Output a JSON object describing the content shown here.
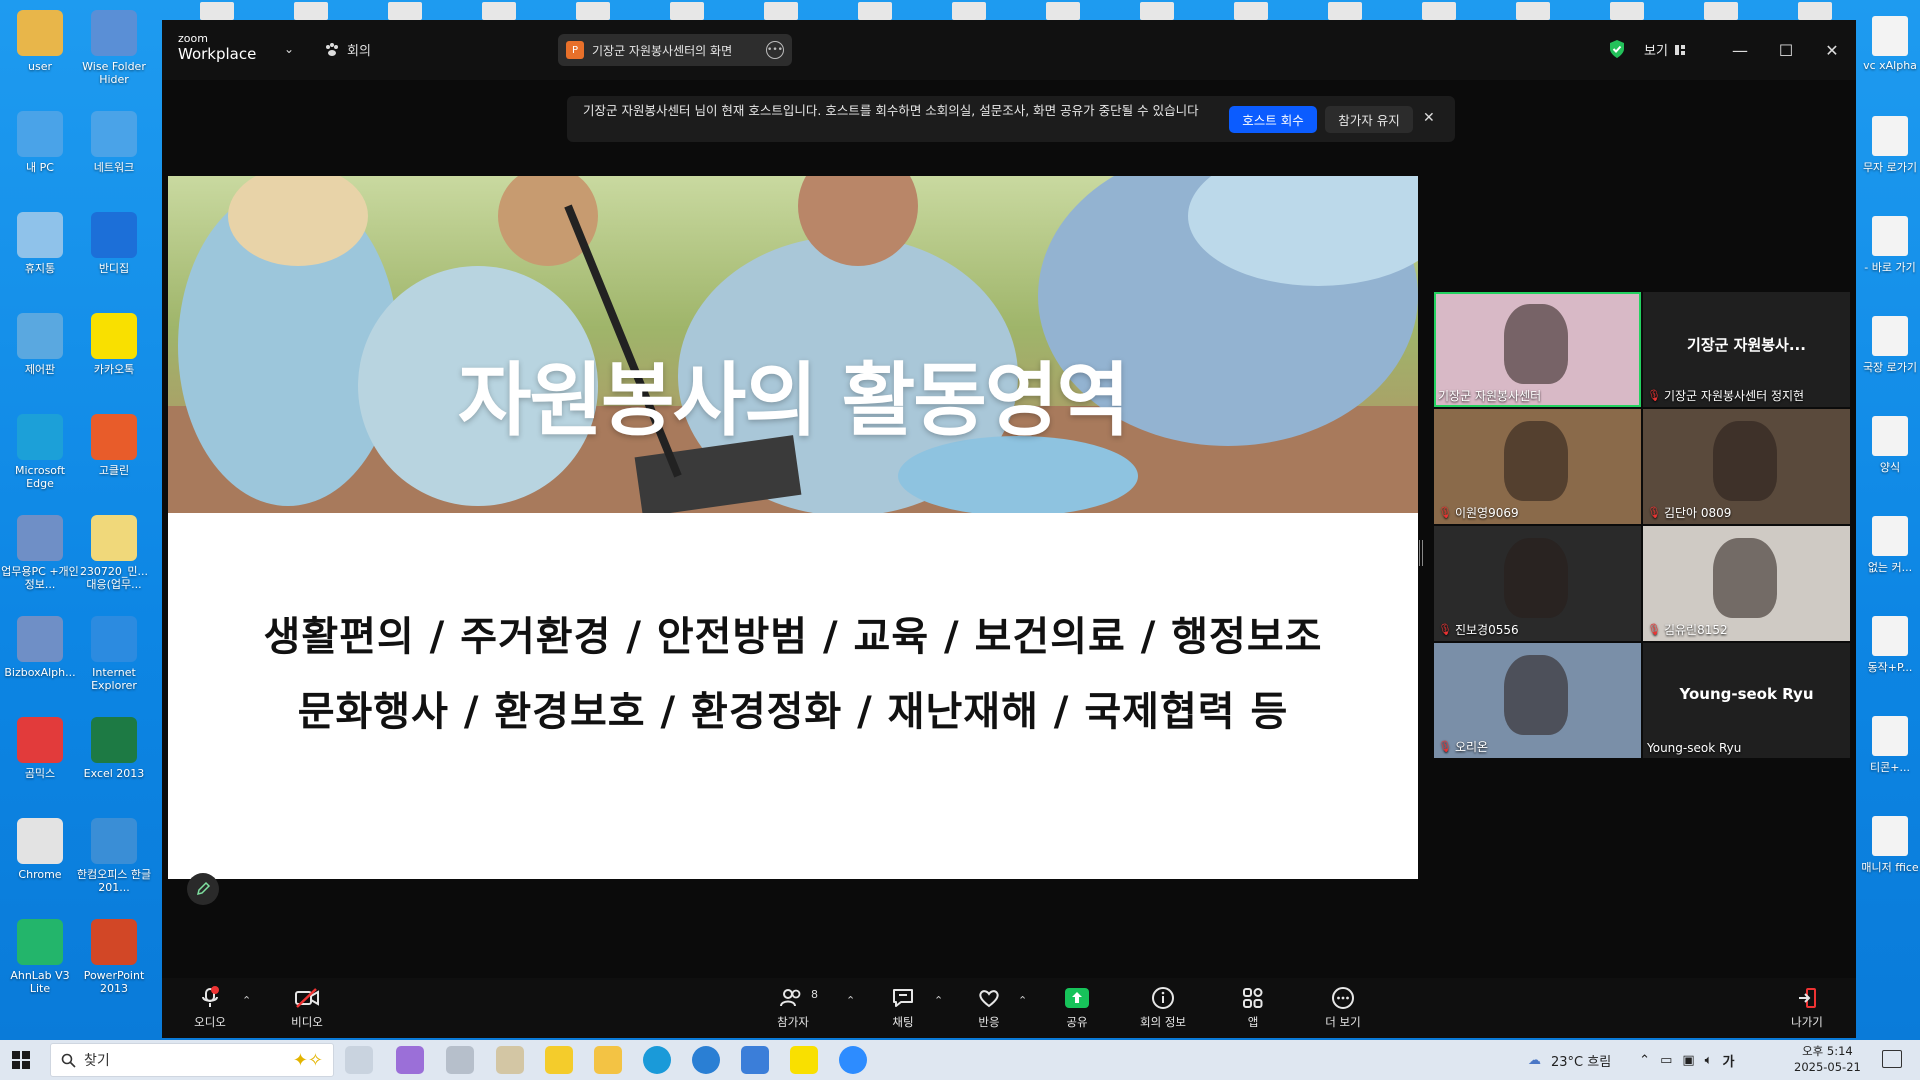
{
  "desktop": {
    "icons": [
      {
        "label": "user",
        "icon": "user-folder-icon",
        "color": "#e8b64a"
      },
      {
        "label": "Wise Folder Hider",
        "icon": "folder-hider-icon",
        "color": "#5a8fd6"
      },
      {
        "label": "내 PC",
        "icon": "pc-icon",
        "color": "#4aa3e8"
      },
      {
        "label": "네트워크",
        "icon": "network-icon",
        "color": "#4aa3e8"
      },
      {
        "label": "휴지통",
        "icon": "recycle-bin-icon",
        "color": "#8fc2ea"
      },
      {
        "label": "반디집",
        "icon": "bandizip-icon",
        "color": "#1c6fd8"
      },
      {
        "label": "제어판",
        "icon": "control-panel-icon",
        "color": "#5aa8e0"
      },
      {
        "label": "카카오톡",
        "icon": "kakaotalk-icon",
        "color": "#f9e000"
      },
      {
        "label": "Microsoft Edge",
        "icon": "edge-icon",
        "color": "#1ca0d8"
      },
      {
        "label": "고클린",
        "icon": "goclean-icon",
        "color": "#e85c2a"
      },
      {
        "label": "업무용PC +개인정보...",
        "icon": "zip-icon",
        "color": "#6f8fc6"
      },
      {
        "label": "230720_민... 대응(업무...",
        "icon": "document-icon",
        "color": "#f0d87a"
      },
      {
        "label": "BizboxAlph...",
        "icon": "zip-icon",
        "color": "#6f8fc6"
      },
      {
        "label": "Internet Explorer",
        "icon": "ie-icon",
        "color": "#2c8be0"
      },
      {
        "label": "곰믹스",
        "icon": "gommix-icon",
        "color": "#e23b3b"
      },
      {
        "label": "Excel 2013",
        "icon": "excel-icon",
        "color": "#1d7a44"
      },
      {
        "label": "Chrome",
        "icon": "chrome-icon",
        "color": "#e3e3e3"
      },
      {
        "label": "한컴오피스 한글 201...",
        "icon": "hancom-icon",
        "color": "#3a8ed6"
      },
      {
        "label": "AhnLab V3 Lite",
        "icon": "v3-icon",
        "color": "#23b56b"
      },
      {
        "label": "PowerPoint 2013",
        "icon": "powerpoint-icon",
        "color": "#d24726"
      }
    ],
    "right_items": [
      {
        "label": "vc xAlpha"
      },
      {
        "label": "무자 로가기"
      },
      {
        "label": "- 바로 가기"
      },
      {
        "label": "국장 로가기"
      },
      {
        "label": "양식"
      },
      {
        "label": "없는 커..."
      },
      {
        "label": "동작+P..."
      },
      {
        "label": "티콘+..."
      },
      {
        "label": "매니저 ffice"
      }
    ]
  },
  "zoom": {
    "logo_line1": "zoom",
    "logo_line2": "Workplace",
    "meeting_label": "회의",
    "share_label": "기장군 자원봉사센터의 화면",
    "view_label": "보기",
    "banner": {
      "text": "기장군 자원봉사센터 님이 현재 호스트입니다. 호스트를 회수하면 소회의실, 설문조사, 화면 공유가 중단될 수 있습니다",
      "reclaim": "호스트 회수",
      "keep": "참가자 유지"
    },
    "slide": {
      "title": "자원봉사의 활동영역",
      "line1": "생활편의 / 주거환경 / 안전방범 / 교육 / 보건의료 / 행정보조",
      "line2": "문화행사 / 환경보호 / 환경정화 / 재난재해 / 국제협력 등"
    },
    "participants": [
      {
        "name": "기장군 자원봉사센터",
        "video": true,
        "muted": false,
        "active": true
      },
      {
        "name": "기장군 자원봉사센터 정지현",
        "center": "기장군 자원봉사...",
        "video": false,
        "muted": true
      },
      {
        "name": "이원영9069",
        "video": true,
        "muted": true
      },
      {
        "name": "김단아 0809",
        "video": true,
        "muted": true
      },
      {
        "name": "진보경0556",
        "video": true,
        "muted": true
      },
      {
        "name": "김유린8152",
        "video": true,
        "muted": true
      },
      {
        "name": "오리온",
        "video": true,
        "muted": true
      },
      {
        "name": "Young-seok Ryu",
        "center": "Young-seok Ryu",
        "video": false,
        "muted": false
      }
    ],
    "toolbar": {
      "audio": "오디오",
      "video": "비디오",
      "participants": "참가자",
      "participant_count": "8",
      "chat": "채팅",
      "reactions": "반응",
      "share": "공유",
      "info": "회의 정보",
      "apps": "앱",
      "more": "더 보기",
      "leave": "나가기"
    }
  },
  "taskbar": {
    "search_placeholder": "찾기",
    "weather": "23°C 흐림",
    "ime": "가",
    "time": "오후 5:14",
    "date": "2025-05-21"
  },
  "colors": {
    "accent": "#0b5cff",
    "active_speaker": "#23d160",
    "muted": "#e33333",
    "share_green": "#17c35a"
  }
}
